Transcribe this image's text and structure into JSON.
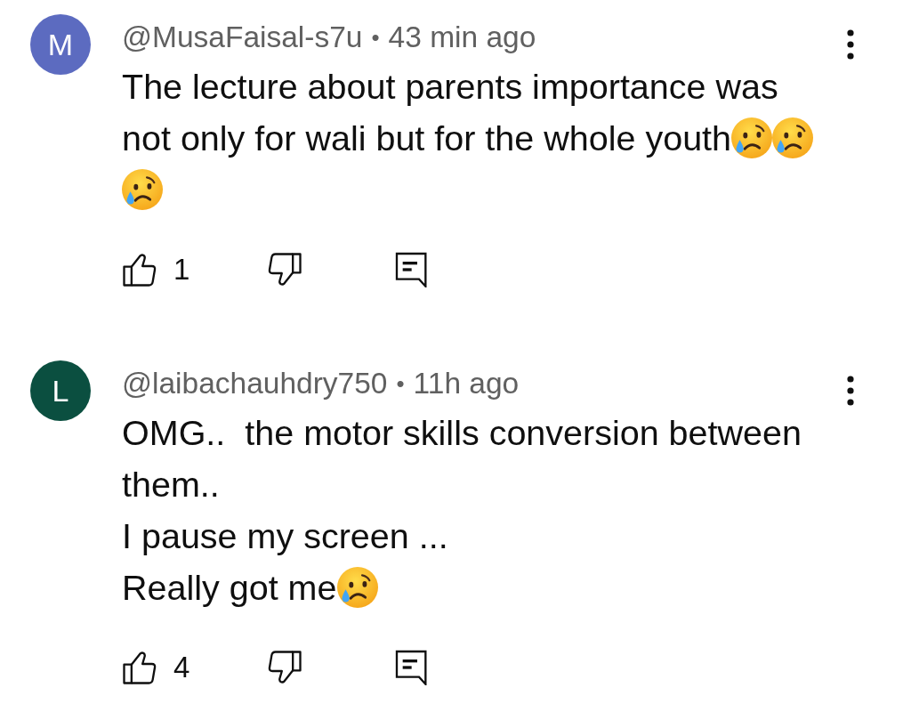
{
  "comments": [
    {
      "avatar": {
        "letter": "M",
        "color": "#5c6bc0"
      },
      "author": "@MusaFaisal-s7u",
      "separator": "•",
      "time": "43 min ago",
      "lines": [
        [
          {
            "kind": "text",
            "text": "The lecture about parents importance was"
          }
        ],
        [
          {
            "kind": "text",
            "text": "not only for wali but for the whole youth"
          },
          {
            "kind": "emoji"
          },
          {
            "kind": "emoji"
          }
        ],
        [
          {
            "kind": "emoji"
          }
        ]
      ],
      "likes": "1"
    },
    {
      "avatar": {
        "letter": "L",
        "color": "#0b4f40"
      },
      "author": "@laibachauhdry750",
      "separator": "•",
      "time": "11h ago",
      "lines": [
        [
          {
            "kind": "text",
            "text": "OMG..  the motor skills conversion between them.."
          }
        ],
        [
          {
            "kind": "text",
            "text": "I pause my screen ..."
          }
        ],
        [
          {
            "kind": "text",
            "text": "Really got me"
          },
          {
            "kind": "emoji"
          }
        ]
      ],
      "likes": "4"
    }
  ]
}
